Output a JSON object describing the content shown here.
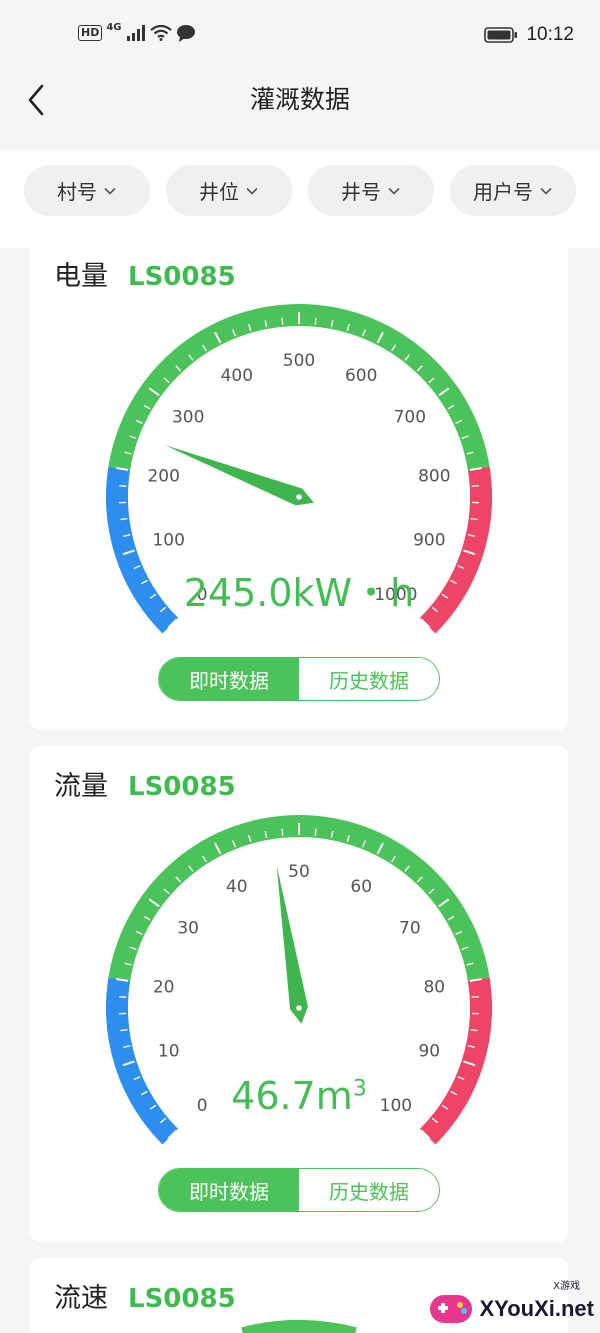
{
  "status_bar": {
    "hd": "HD",
    "network": "4G",
    "time": "10:12"
  },
  "header": {
    "title": "灌溉数据"
  },
  "filters": [
    {
      "label": "村号"
    },
    {
      "label": "井位"
    },
    {
      "label": "井号"
    },
    {
      "label": "用户号"
    }
  ],
  "cards": [
    {
      "label": "电量",
      "code": "LS0085",
      "value_text": "245.0kW・h",
      "gauge": {
        "min": 0,
        "max": 1000,
        "value": 245.0,
        "ticks": [
          "0",
          "100",
          "200",
          "300",
          "400",
          "500",
          "600",
          "700",
          "800",
          "900",
          "1000"
        ]
      },
      "tabs": {
        "active": "即时数据",
        "inactive": "历史数据"
      }
    },
    {
      "label": "流量",
      "code": "LS0085",
      "value_text": "46.7m",
      "value_sup": "3",
      "gauge": {
        "min": 0,
        "max": 100,
        "value": 46.7,
        "ticks": [
          "0",
          "10",
          "20",
          "30",
          "40",
          "50",
          "60",
          "70",
          "80",
          "90",
          "100"
        ]
      },
      "tabs": {
        "active": "即时数据",
        "inactive": "历史数据"
      }
    },
    {
      "label": "流速",
      "code": "LS0085"
    }
  ],
  "colors": {
    "green": "#4cc25b",
    "blue": "#2d8ef0",
    "red": "#ee4466",
    "needle": "#3fb54e"
  },
  "watermark": {
    "brand": "XYouXi.net",
    "small": "X游戏"
  }
}
